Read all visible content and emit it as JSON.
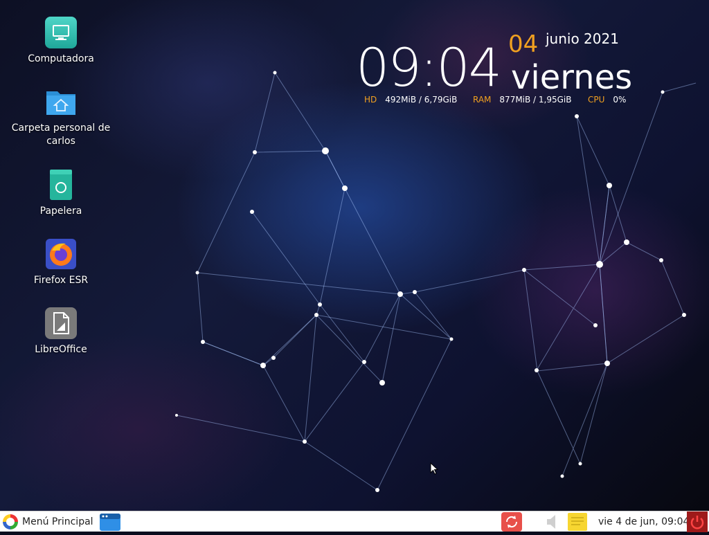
{
  "desktop_icons": [
    {
      "label": "Computadora",
      "icon": "computer-icon"
    },
    {
      "label": "Carpeta personal de carlos",
      "icon": "home-folder-icon"
    },
    {
      "label": "Papelera",
      "icon": "trash-icon"
    },
    {
      "label": "Firefox ESR",
      "icon": "firefox-icon"
    },
    {
      "label": "LibreOffice",
      "icon": "libreoffice-icon"
    }
  ],
  "conky": {
    "time": "09:04",
    "day": "04",
    "month_year": "junio 2021",
    "weekday": "viernes",
    "hd_label": "HD",
    "hd_value": "492MiB / 6,79GiB",
    "ram_label": "RAM",
    "ram_value": "877MiB / 1,95GiB",
    "cpu_label": "CPU",
    "cpu_value": "0%",
    "accent": "#f0a020"
  },
  "taskbar": {
    "menu_label": "Menú Principal",
    "clock": "vie  4 de jun, 09:04",
    "icons": [
      "files-icon",
      "update-icon",
      "volume-icon",
      "notes-icon",
      "power-icon"
    ]
  }
}
